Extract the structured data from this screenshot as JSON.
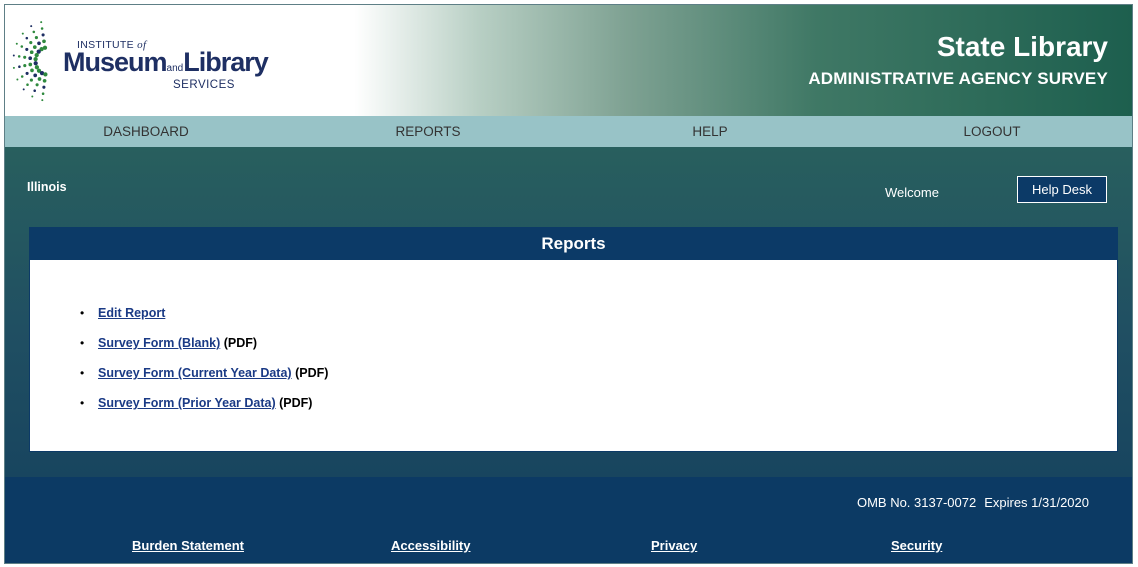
{
  "header": {
    "logo": {
      "line1": "INSTITUTE",
      "of": "of",
      "museum": "Museum",
      "and": "and",
      "library": "Library",
      "services": "SERVICES"
    },
    "title": "State Library",
    "subtitle": "ADMINISTRATIVE AGENCY SURVEY"
  },
  "nav": {
    "items": [
      {
        "label": "DASHBOARD"
      },
      {
        "label": "REPORTS"
      },
      {
        "label": "HELP"
      },
      {
        "label": "LOGOUT"
      }
    ]
  },
  "user": {
    "state": "Illinois",
    "welcome": "Welcome",
    "help_desk_label": "Help Desk"
  },
  "reports": {
    "heading": "Reports",
    "items": [
      {
        "bullet": "•",
        "label": "Edit Report",
        "suffix": ""
      },
      {
        "bullet": "•",
        "label": "Survey Form (Blank)",
        "suffix": "(PDF)"
      },
      {
        "bullet": "•",
        "label": "Survey Form (Current Year Data)",
        "suffix": "(PDF)"
      },
      {
        "bullet": "•",
        "label": "Survey Form (Prior Year Data)",
        "suffix": "(PDF)"
      }
    ]
  },
  "footer": {
    "omb_number": "OMB No. 3137-0072",
    "expires": "Expires 1/31/2020",
    "links": [
      {
        "label": "Burden Statement"
      },
      {
        "label": "Accessibility"
      },
      {
        "label": "Privacy"
      },
      {
        "label": "Security"
      }
    ]
  },
  "colors": {
    "nav_bg": "#98c3c7",
    "panel_header": "#0c3a67",
    "footer_bg": "#0c3a64",
    "link": "#1a3a85",
    "logo_green": "#2f8a3e",
    "logo_navy": "#1e2f63"
  },
  "icons": {
    "logo_mark": "dot-burst-logo-icon"
  }
}
